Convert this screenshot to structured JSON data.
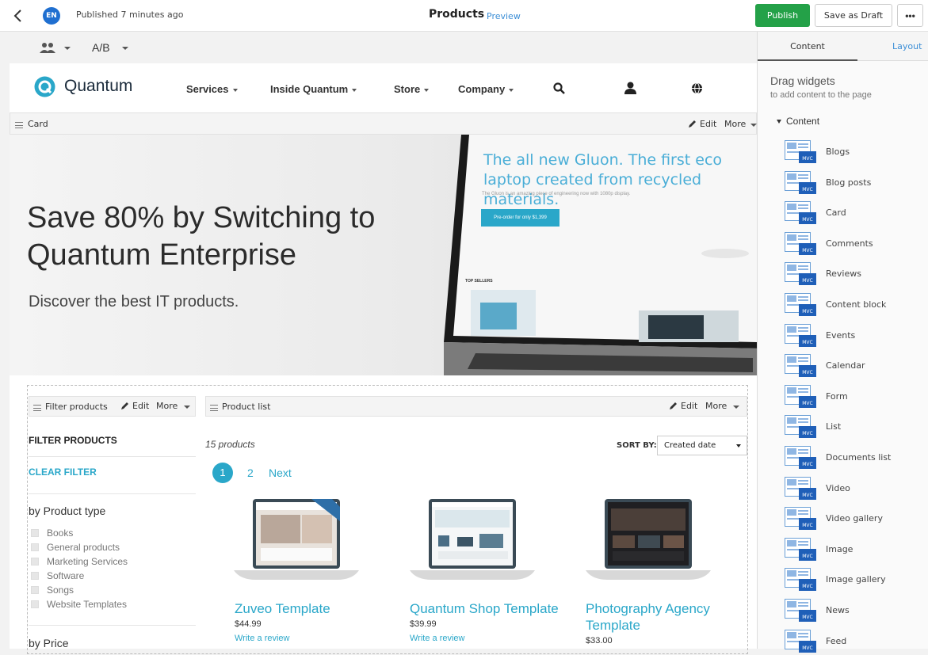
{
  "topbar": {
    "avatar_initials": "EN",
    "status": "Published 7 minutes ago",
    "page_title": "Products",
    "preview_label": "Preview",
    "publish_label": "Publish",
    "save_draft_label": "Save as Draft",
    "more_label": "•••"
  },
  "toolbar2": {
    "ab_label": "A/B"
  },
  "site": {
    "logo_text": "Quantum",
    "nav": [
      "Services",
      "Inside Quantum",
      "Store",
      "Company"
    ]
  },
  "card_bar": {
    "label": "Card",
    "edit": "Edit",
    "more": "More"
  },
  "hero": {
    "title_line1": "Save 80% by Switching to",
    "title_line2": "Quantum Enterprise",
    "subtitle": "Discover the best IT products.",
    "laptop_heading": "The all new Gluon. The first eco laptop created from recycled materials.",
    "laptop_small": "The Gluon is an amazing piece of engineering now with 1080p display.",
    "laptop_button": "Pre-order for only $1,399",
    "laptop_section": "TOP SELLERS"
  },
  "filter_bar": {
    "label": "Filter products",
    "edit": "Edit",
    "more": "More"
  },
  "list_bar": {
    "label": "Product list",
    "edit": "Edit",
    "more": "More"
  },
  "filter": {
    "title": "FILTER PRODUCTS",
    "clear": "CLEAR FILTER",
    "group1": "by Product type",
    "types": [
      "Books",
      "General products",
      "Marketing Services",
      "Software",
      "Songs",
      "Website Templates"
    ],
    "group2": "by Price"
  },
  "list": {
    "count": "15 products",
    "sort_label": "SORT BY:",
    "sort_value": "Created date",
    "pages": [
      "1",
      "2"
    ],
    "next": "Next",
    "products": [
      {
        "title": "Zuveo Template",
        "price": "$44.99",
        "review": "Write a review"
      },
      {
        "title": "Quantum Shop Template",
        "price": "$39.99",
        "review": "Write a review"
      },
      {
        "title": "Photography Agency Template",
        "price": "$33.00",
        "review": ""
      }
    ]
  },
  "panel": {
    "tab_content": "Content",
    "tab_layout": "Layout",
    "drag_title": "Drag widgets",
    "drag_sub": "to add content to the page",
    "section": "Content",
    "badge": "MVC",
    "widgets": [
      "Blogs",
      "Blog posts",
      "Card",
      "Comments",
      "Reviews",
      "Content block",
      "Events",
      "Calendar",
      "Form",
      "List",
      "Documents list",
      "Video",
      "Video gallery",
      "Image",
      "Image gallery",
      "News",
      "Feed"
    ]
  },
  "colors": {
    "publish": "#24a148",
    "accent": "#2aa7c9",
    "link": "#3b8ed6"
  }
}
